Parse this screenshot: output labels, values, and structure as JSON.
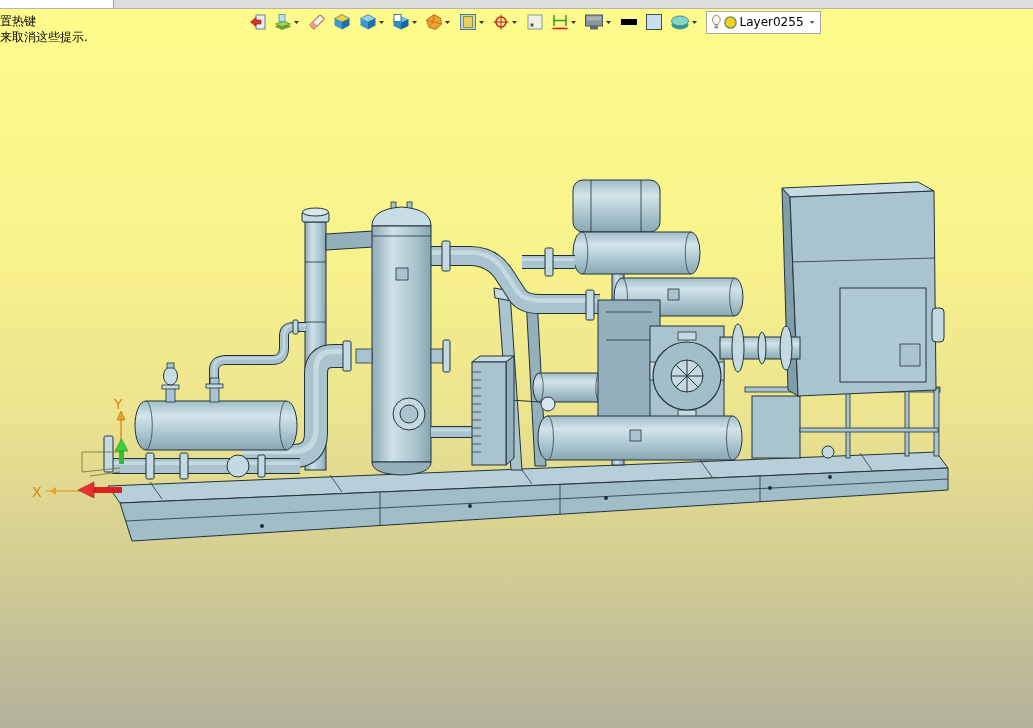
{
  "hint": {
    "lines": [
      "置热键",
      "来取消这些提示."
    ]
  },
  "toolbar": {
    "tools": [
      {
        "kind": "button",
        "dropdown": false
      },
      {
        "kind": "button",
        "dropdown": true
      },
      {
        "kind": "button",
        "dropdown": false
      },
      {
        "kind": "button",
        "dropdown": false
      },
      {
        "kind": "button",
        "dropdown": true
      },
      {
        "kind": "button",
        "dropdown": true
      },
      {
        "kind": "button",
        "dropdown": true
      },
      {
        "kind": "button",
        "dropdown": true
      },
      {
        "kind": "button",
        "dropdown": true
      },
      {
        "kind": "button",
        "dropdown": false
      },
      {
        "kind": "button",
        "dropdown": true
      },
      {
        "kind": "button",
        "dropdown": true
      },
      {
        "kind": "line_swatch",
        "color": "#000000"
      },
      {
        "kind": "fill_swatch",
        "color": "#c5e0f4"
      },
      {
        "kind": "button",
        "dropdown": true
      }
    ]
  },
  "layer_select": {
    "value": "Layer0255"
  },
  "axes": {
    "x_label": "X",
    "y_label": "Y"
  }
}
